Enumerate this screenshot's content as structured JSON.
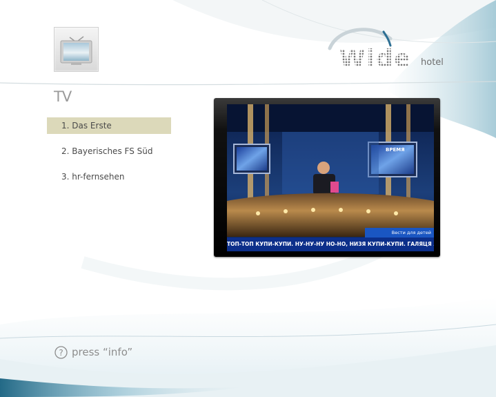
{
  "brand": {
    "logo_word": "Wide",
    "logo_suffix": "hotel"
  },
  "section": {
    "title": "TV",
    "icon": "tv-icon"
  },
  "channels": [
    {
      "label": "1. Das Erste",
      "selected": true
    },
    {
      "label": "2. Bayerisches FS Süd",
      "selected": false
    },
    {
      "label": "3. hr-fernsehen",
      "selected": false
    }
  ],
  "preview": {
    "caption": "Вести для детей",
    "ticker": "ТОП-ТОП КУПИ-КУПИ. НУ-НУ-НУ НО-НО, НИЗЯ КУПИ-КУПИ. ГАЛЯЦЯ ЖИЖА! НО"
  },
  "help": {
    "icon": "question-circle-icon",
    "label": "press “info”"
  },
  "colors": {
    "selection": "#dcd9ba",
    "text": "#4a4a4a",
    "muted": "#8d8d8d",
    "ticker": "#0c2f8a"
  }
}
